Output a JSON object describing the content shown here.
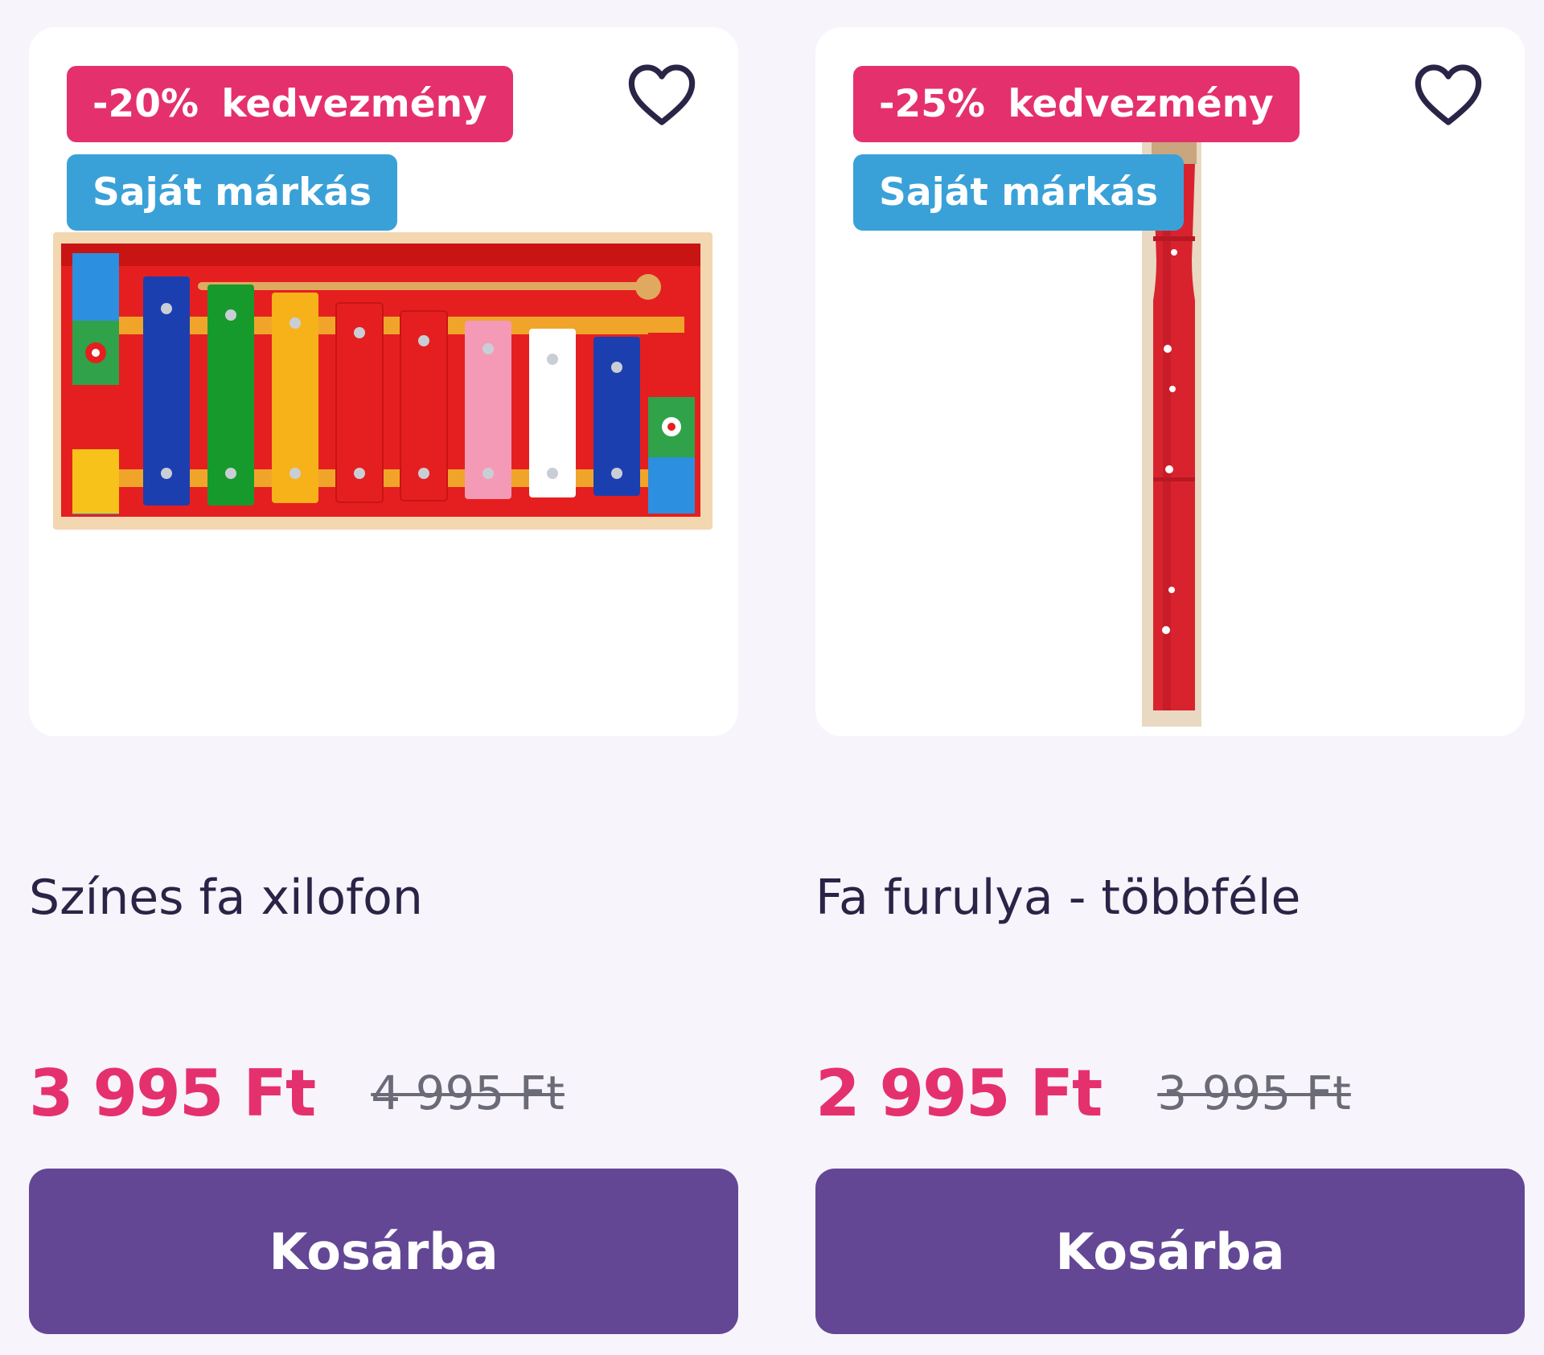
{
  "products": [
    {
      "discount_badge": "-20% kedvezmény",
      "brand_badge": "Saját márkás",
      "title": "Színes fa xilofon",
      "price_current": "3 995 Ft",
      "price_old": "4 995 Ft",
      "cart_label": "Kosárba",
      "image": "wooden-xylophone",
      "favorite_icon": "heart-outline-icon"
    },
    {
      "discount_badge": "-25% kedvezmény",
      "brand_badge": "Saját márkás",
      "title": "Fa furulya - többféle",
      "price_current": "2 995 Ft",
      "price_old": "3 995 Ft",
      "cart_label": "Kosárba",
      "image": "wooden-recorder",
      "favorite_icon": "heart-outline-icon"
    }
  ],
  "colors": {
    "page_background": "#f7f4fb",
    "discount_badge": "#e5306e",
    "brand_badge": "#3aa1d8",
    "price_current": "#e5306e",
    "cart_button": "#634795",
    "title_text": "#2a2447"
  }
}
